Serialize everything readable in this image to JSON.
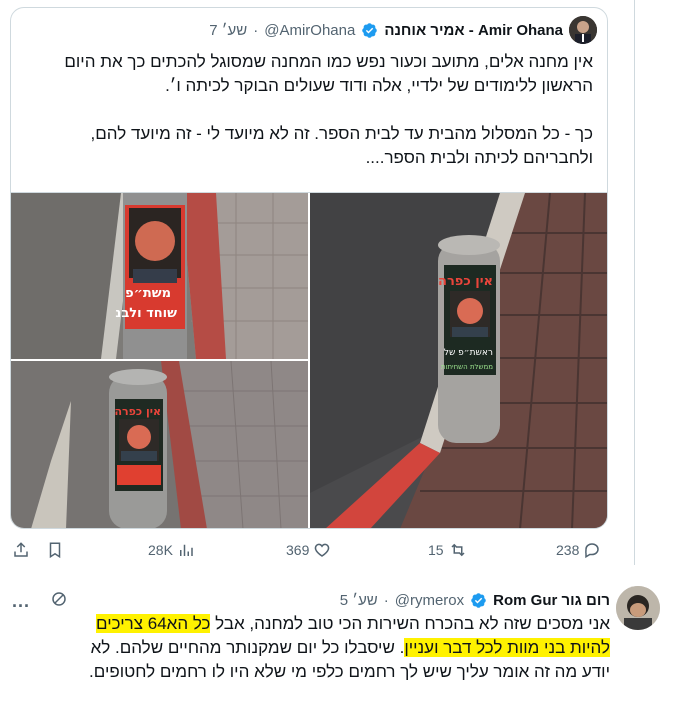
{
  "quoted_tweet": {
    "author_name": "אמיר אוחנה - Amir Ohana",
    "handle": "@AmirOhana",
    "time": "7 שע׳",
    "separator": "·",
    "text_p1": "אין מחנה אלים, מתועב וכעור נפש כמו המחנה שמסוגל להכתים כך את היום הראשון ללימודים של ילדיי, אלה ודוד שעולים הבוקר לכיתה ו׳.",
    "text_p2": "כך - כל המסלול מהבית עד לבית הספר. זה לא מיועד לי - זה מיועד להם, ולחבריהם לכיתה ולבית הספר....",
    "stickers": {
      "top": "אין כפרה",
      "bottom_1": "משת״פ",
      "bottom_2": "שוחד ולבנ",
      "bottom_small": "ראשת״פ של",
      "bottom_tiny": "ממשלת השחיתות"
    },
    "stats": {
      "views": "28K",
      "likes": "369",
      "retweets": "15",
      "replies": "238"
    }
  },
  "reply": {
    "author_name": "Rom Gur רום גור",
    "handle": "@rymerox",
    "time": "5 שע׳",
    "separator": "·",
    "more": "...",
    "line1_a": "אני מסכים שזה לא בהכרח השירות הכי טוב למחנה, אבל ",
    "line1_hl": "כל הא64 צריכים",
    "line2_hl_a": "להיות בני מוות לכל דבר ועניין",
    "line2_b": ". שיסבלו כל יום שמקנותר מהחיים שלהם. לא",
    "line3": "יודע מה זה אומר עליך שיש לך רחמים כלפי מי שלא היו לו רחמים לחטופים."
  },
  "colors": {
    "verified": "#1d9bf0",
    "muted": "#536471",
    "highlight": "#fff200"
  },
  "icons": [
    "verified-icon",
    "share-icon",
    "bookmark-icon",
    "views-icon",
    "like-icon",
    "retweet-icon",
    "reply-icon",
    "more-icon",
    "ban-icon"
  ]
}
